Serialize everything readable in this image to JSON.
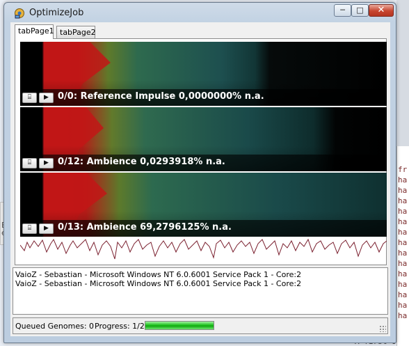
{
  "window": {
    "title": "OptimizeJob",
    "minimize_glyph": "─",
    "maximize_glyph": "□",
    "close_glyph": "✕",
    "app_icon": "app-gear-icon"
  },
  "tabs": [
    {
      "label": "tabPage1",
      "selected": true
    },
    {
      "label": "tabPage2",
      "selected": false
    }
  ],
  "strips": [
    {
      "label": "0/0: Reference Impulse 0,0000000% n.a.",
      "save_icon": "⌸",
      "play_icon": "▶"
    },
    {
      "label": "0/12: Ambience 0,0293918% n.a.",
      "save_icon": "⌸",
      "play_icon": "▶"
    },
    {
      "label": "0/13: Ambience 69,2796125% n.a.",
      "save_icon": "⌸",
      "play_icon": "▶"
    }
  ],
  "log": {
    "lines": [
      "VaioZ - Sebastian - Microsoft Windows NT 6.0.6001 Service Pack 1 - Core:2",
      "VaioZ - Sebastian - Microsoft Windows NT 6.0.6001 Service Pack 1 - Core:2"
    ]
  },
  "status": {
    "queued": "Queued Genomes: 0",
    "progress_label": "Progress: 1/2",
    "progress_value": 0.5
  },
  "colors": {
    "spectrum_red": "#c0151a",
    "spectrum_green": "#3f8f3f",
    "spectrum_teal": "#1d5f5a",
    "progress_green": "#22c322",
    "waveform": "#7a1f2e"
  }
}
